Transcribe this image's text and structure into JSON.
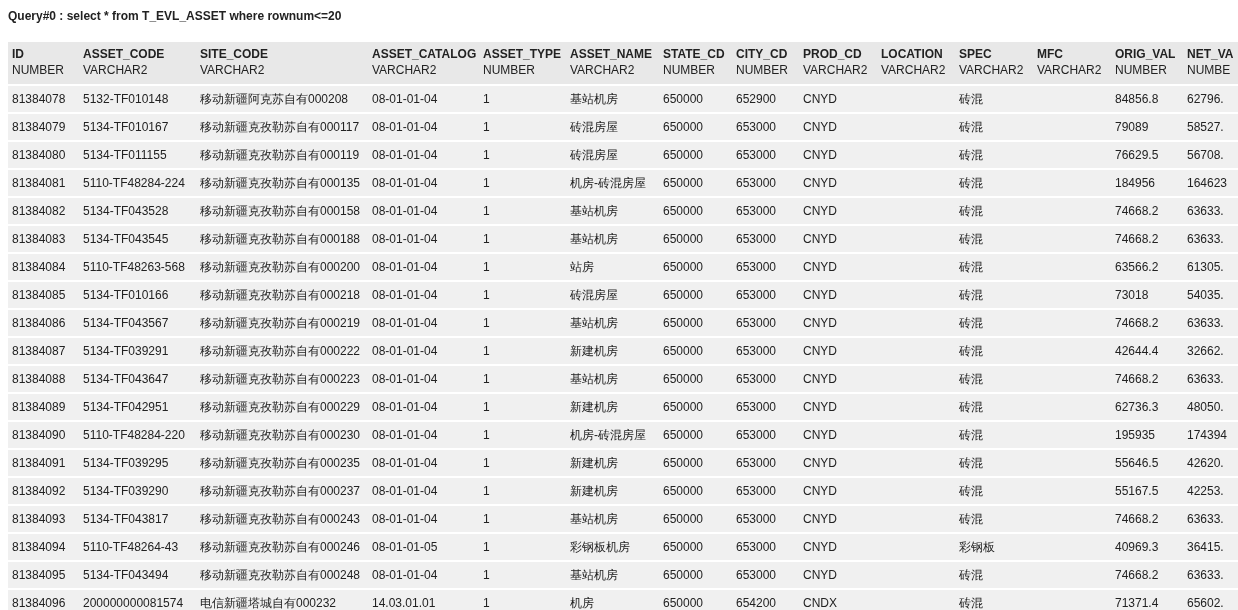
{
  "query_title": "Query#0 : select * from T_EVL_ASSET where rownum<=20",
  "table": {
    "columns": [
      {
        "name": "ID",
        "type": "NUMBER"
      },
      {
        "name": "ASSET_CODE",
        "type": "VARCHAR2"
      },
      {
        "name": "SITE_CODE",
        "type": "VARCHAR2"
      },
      {
        "name": "ASSET_CATALOG",
        "type": "VARCHAR2"
      },
      {
        "name": "ASSET_TYPE",
        "type": "NUMBER"
      },
      {
        "name": "ASSET_NAME",
        "type": "VARCHAR2"
      },
      {
        "name": "STATE_CD",
        "type": "NUMBER"
      },
      {
        "name": "CITY_CD",
        "type": "NUMBER"
      },
      {
        "name": "PROD_CD",
        "type": "VARCHAR2"
      },
      {
        "name": "LOCATION",
        "type": "VARCHAR2"
      },
      {
        "name": "SPEC",
        "type": "VARCHAR2"
      },
      {
        "name": "MFC",
        "type": "VARCHAR2"
      },
      {
        "name": "ORIG_VAL",
        "type": "NUMBER"
      },
      {
        "name": "NET_VA",
        "type": "NUMBE"
      }
    ],
    "rows": [
      [
        "81384078",
        "5132-TF010148",
        "移动新疆阿克苏自有000208",
        "08-01-01-04",
        "1",
        "基站机房",
        "650000",
        "652900",
        "CNYD",
        null,
        "砖混",
        null,
        "84856.8",
        "62796."
      ],
      [
        "81384079",
        "5134-TF010167",
        "移动新疆克孜勒苏自有000117",
        "08-01-01-04",
        "1",
        "砖混房屋",
        "650000",
        "653000",
        "CNYD",
        null,
        "砖混",
        null,
        "79089",
        "58527."
      ],
      [
        "81384080",
        "5134-TF011155",
        "移动新疆克孜勒苏自有000119",
        "08-01-01-04",
        "1",
        "砖混房屋",
        "650000",
        "653000",
        "CNYD",
        null,
        "砖混",
        null,
        "76629.5",
        "56708."
      ],
      [
        "81384081",
        "5110-TF48284-224",
        "移动新疆克孜勒苏自有000135",
        "08-01-01-04",
        "1",
        "机房-砖混房屋",
        "650000",
        "653000",
        "CNYD",
        null,
        "砖混",
        null,
        "184956",
        "164623"
      ],
      [
        "81384082",
        "5134-TF043528",
        "移动新疆克孜勒苏自有000158",
        "08-01-01-04",
        "1",
        "基站机房",
        "650000",
        "653000",
        "CNYD",
        null,
        "砖混",
        null,
        "74668.2",
        "63633."
      ],
      [
        "81384083",
        "5134-TF043545",
        "移动新疆克孜勒苏自有000188",
        "08-01-01-04",
        "1",
        "基站机房",
        "650000",
        "653000",
        "CNYD",
        null,
        "砖混",
        null,
        "74668.2",
        "63633."
      ],
      [
        "81384084",
        "5110-TF48263-568",
        "移动新疆克孜勒苏自有000200",
        "08-01-01-04",
        "1",
        "站房",
        "650000",
        "653000",
        "CNYD",
        null,
        "砖混",
        null,
        "63566.2",
        "61305."
      ],
      [
        "81384085",
        "5134-TF010166",
        "移动新疆克孜勒苏自有000218",
        "08-01-01-04",
        "1",
        "砖混房屋",
        "650000",
        "653000",
        "CNYD",
        null,
        "砖混",
        null,
        "73018",
        "54035."
      ],
      [
        "81384086",
        "5134-TF043567",
        "移动新疆克孜勒苏自有000219",
        "08-01-01-04",
        "1",
        "基站机房",
        "650000",
        "653000",
        "CNYD",
        null,
        "砖混",
        null,
        "74668.2",
        "63633."
      ],
      [
        "81384087",
        "5134-TF039291",
        "移动新疆克孜勒苏自有000222",
        "08-01-01-04",
        "1",
        "新建机房",
        "650000",
        "653000",
        "CNYD",
        null,
        "砖混",
        null,
        "42644.4",
        "32662."
      ],
      [
        "81384088",
        "5134-TF043647",
        "移动新疆克孜勒苏自有000223",
        "08-01-01-04",
        "1",
        "基站机房",
        "650000",
        "653000",
        "CNYD",
        null,
        "砖混",
        null,
        "74668.2",
        "63633."
      ],
      [
        "81384089",
        "5134-TF042951",
        "移动新疆克孜勒苏自有000229",
        "08-01-01-04",
        "1",
        "新建机房",
        "650000",
        "653000",
        "CNYD",
        null,
        "砖混",
        null,
        "62736.3",
        "48050."
      ],
      [
        "81384090",
        "5110-TF48284-220",
        "移动新疆克孜勒苏自有000230",
        "08-01-01-04",
        "1",
        "机房-砖混房屋",
        "650000",
        "653000",
        "CNYD",
        null,
        "砖混",
        null,
        "195935",
        "174394"
      ],
      [
        "81384091",
        "5134-TF039295",
        "移动新疆克孜勒苏自有000235",
        "08-01-01-04",
        "1",
        "新建机房",
        "650000",
        "653000",
        "CNYD",
        null,
        "砖混",
        null,
        "55646.5",
        "42620."
      ],
      [
        "81384092",
        "5134-TF039290",
        "移动新疆克孜勒苏自有000237",
        "08-01-01-04",
        "1",
        "新建机房",
        "650000",
        "653000",
        "CNYD",
        null,
        "砖混",
        null,
        "55167.5",
        "42253."
      ],
      [
        "81384093",
        "5134-TF043817",
        "移动新疆克孜勒苏自有000243",
        "08-01-01-04",
        "1",
        "基站机房",
        "650000",
        "653000",
        "CNYD",
        null,
        "砖混",
        null,
        "74668.2",
        "63633."
      ],
      [
        "81384094",
        "5110-TF48264-43",
        "移动新疆克孜勒苏自有000246",
        "08-01-01-05",
        "1",
        "彩钢板机房",
        "650000",
        "653000",
        "CNYD",
        null,
        "彩钢板",
        null,
        "40969.3",
        "36415."
      ],
      [
        "81384095",
        "5134-TF043494",
        "移动新疆克孜勒苏自有000248",
        "08-01-01-04",
        "1",
        "基站机房",
        "650000",
        "653000",
        "CNYD",
        null,
        "砖混",
        null,
        "74668.2",
        "63633."
      ],
      [
        "81384096",
        "200000000081574",
        "电信新疆塔城自有000232",
        "14.03.01.01",
        "1",
        "机房",
        "650000",
        "654200",
        "CNDX",
        null,
        "砖混",
        null,
        "71371.4",
        "65602."
      ]
    ]
  }
}
